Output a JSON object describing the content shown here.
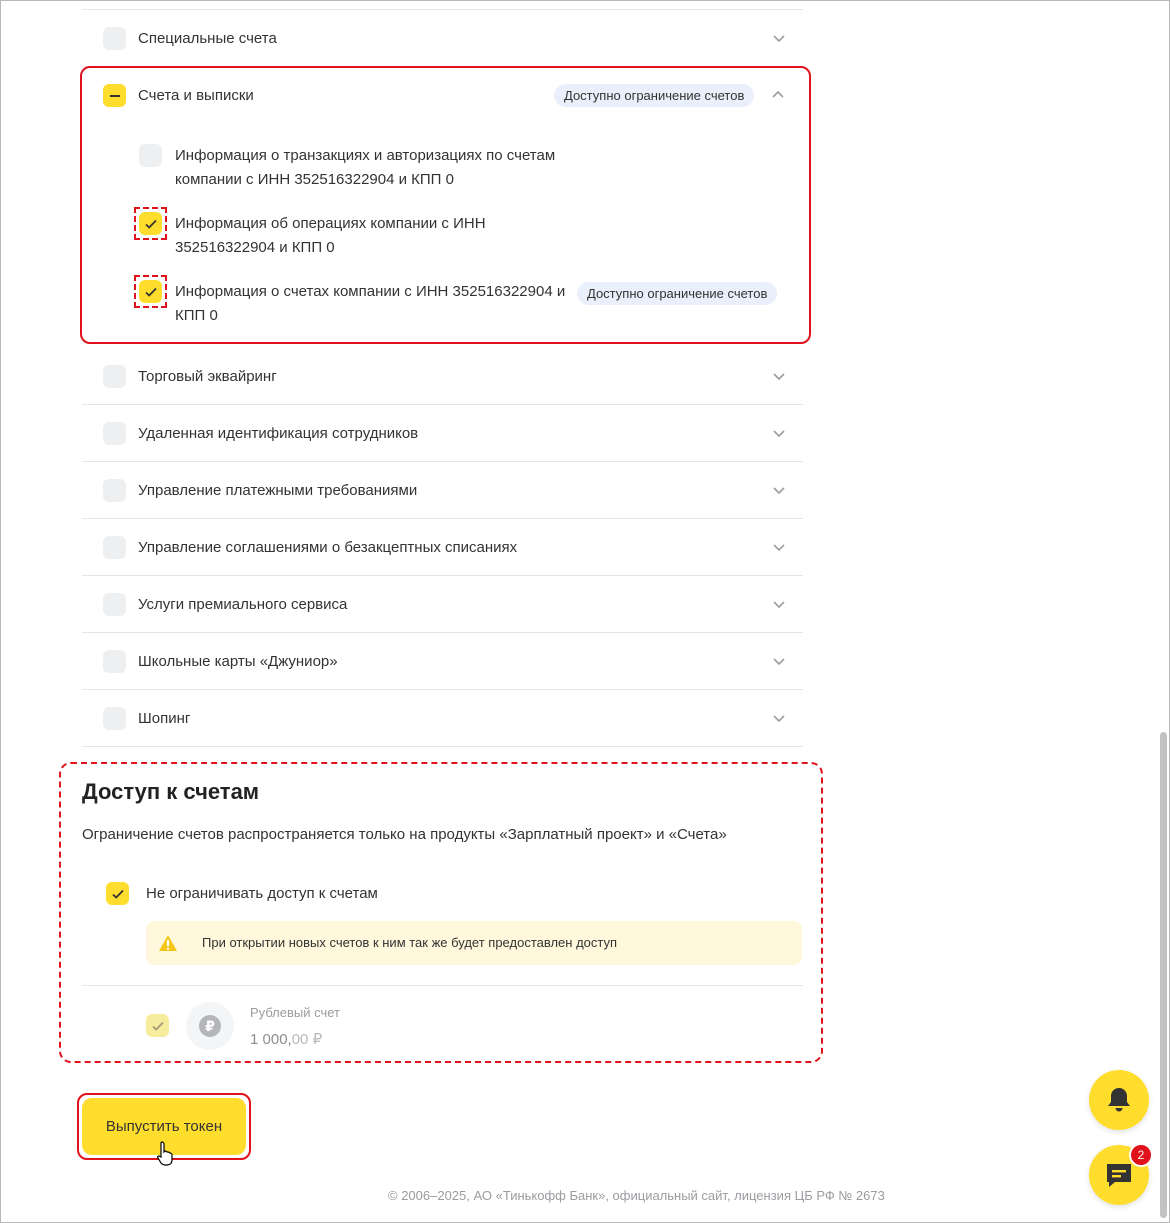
{
  "colors": {
    "accent": "#ffdd2d",
    "highlight_red": "#e0121b",
    "badge_bg": "#e9f0fb",
    "warning_bg": "#fff8dc"
  },
  "permissions": {
    "rows_before": [
      {
        "label": "Специальные счета",
        "checked": false,
        "icon": "chevron-down-icon"
      }
    ],
    "expanded_group": {
      "label": "Счета и выписки",
      "state": "partial",
      "badge": "Доступно ограничение счетов",
      "icon": "chevron-up-icon",
      "items": [
        {
          "line1": "Информация о транзакциях и авторизациях по счетам",
          "line2": "компании с ИНН 352516322904 и КПП 0",
          "checked": false
        },
        {
          "line1": "Информация об операциях компании с ИНН",
          "line2": "352516322904 и КПП 0",
          "checked": true
        },
        {
          "line1": "Информация о счетах компании с ИНН 352516322904 и",
          "line2": "КПП 0",
          "checked": true,
          "badge": "Доступно ограничение счетов"
        }
      ]
    },
    "rows_after": [
      {
        "label": "Торговый эквайринг",
        "checked": false
      },
      {
        "label": "Удаленная идентификация сотрудников",
        "checked": false
      },
      {
        "label": "Управление платежными требованиями",
        "checked": false
      },
      {
        "label": "Управление соглашениями о безакцептных списаниях",
        "checked": false
      },
      {
        "label": "Услуги премиального сервиса",
        "checked": false
      },
      {
        "label": "Школьные карты «Джуниор»",
        "checked": false
      },
      {
        "label": "Шопинг",
        "checked": false
      }
    ]
  },
  "account_access": {
    "title": "Доступ к счетам",
    "description": "Ограничение счетов распространяется только на продукты «Зарплатный проект» и «Счета»",
    "unlimited_label": "Не ограничивать доступ к счетам",
    "unlimited_checked": true,
    "warning_text": "При открытии новых счетов к ним так же будет предоставлен доступ",
    "warning_icon": "warning-icon",
    "account": {
      "name": "Рублевый счет",
      "balance_main": "1 000,",
      "balance_frac": "00 ₽",
      "currency_symbol": "₽",
      "checked": true,
      "disabled": true
    }
  },
  "actions": {
    "issue_token_label": "Выпустить токен"
  },
  "footer": {
    "text": "© 2006–2025, АО «Тинькофф Банк», официальный сайт, лицензия ЦБ РФ № 2673"
  },
  "floating": {
    "bell_icon": "bell-icon",
    "chat_icon": "chat-icon",
    "chat_badge": "2"
  }
}
